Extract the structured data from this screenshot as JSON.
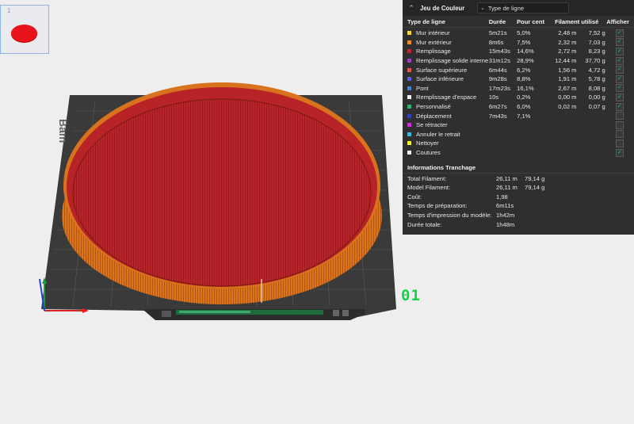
{
  "plate_thumbnail": {
    "index_label": "1"
  },
  "plate_number": "01",
  "bed_logo": "Bam",
  "panel": {
    "title": "Jeu de Couleur",
    "dropdown_value": "Type de ligne",
    "columns": {
      "type": "Type de ligne",
      "duration": "Durée",
      "percent": "Pour cent",
      "filament": "Filament utilisé",
      "show": "Afficher"
    },
    "rows": [
      {
        "label": "Mur intérieur",
        "color": "#f4d53b",
        "duration": "5m21s",
        "percent": "5,0%",
        "length": "2,48 m",
        "weight": "7,52 g",
        "checked": true
      },
      {
        "label": "Mur extérieur",
        "color": "#f08a2a",
        "duration": "8m6s",
        "percent": "7,5%",
        "length": "2,32 m",
        "weight": "7,03 g",
        "checked": true
      },
      {
        "label": "Remplissage",
        "color": "#c1272d",
        "duration": "15m43s",
        "percent": "14,6%",
        "length": "2,72 m",
        "weight": "8,23 g",
        "checked": true
      },
      {
        "label": "Remplissage solide interne",
        "color": "#9c3fbf",
        "duration": "31m12s",
        "percent": "28,9%",
        "length": "12,44 m",
        "weight": "37,70 g",
        "checked": true
      },
      {
        "label": "Surface supérieure",
        "color": "#e2564e",
        "duration": "6m44s",
        "percent": "6,2%",
        "length": "1,56 m",
        "weight": "4,72 g",
        "checked": true
      },
      {
        "label": "Surface inférieure",
        "color": "#5b5fd6",
        "duration": "9m28s",
        "percent": "8,8%",
        "length": "1,91 m",
        "weight": "5,78 g",
        "checked": true
      },
      {
        "label": "Pont",
        "color": "#4a84c8",
        "duration": "17m23s",
        "percent": "16,1%",
        "length": "2,67 m",
        "weight": "8,08 g",
        "checked": true
      },
      {
        "label": "Remplissage d'espace",
        "color": "#f2f2f2",
        "duration": "10s",
        "percent": "0,2%",
        "length": "0,00 m",
        "weight": "0,00 g",
        "checked": true
      },
      {
        "label": "Personnalisé",
        "color": "#2fb36b",
        "duration": "6m27s",
        "percent": "6,0%",
        "length": "0,02 m",
        "weight": "0,07 g",
        "checked": true
      },
      {
        "label": "Déplacement",
        "color": "#2f3fc0",
        "duration": "7m43s",
        "percent": "7,1%",
        "length": "",
        "weight": "",
        "checked": false
      },
      {
        "label": "Se rétracter",
        "color": "#d02fd0",
        "duration": "",
        "percent": "",
        "length": "",
        "weight": "",
        "checked": false
      },
      {
        "label": "Annuler le retrait",
        "color": "#3bb8d8",
        "duration": "",
        "percent": "",
        "length": "",
        "weight": "",
        "checked": false
      },
      {
        "label": "Nettoyer",
        "color": "#f5f53a",
        "duration": "",
        "percent": "",
        "length": "",
        "weight": "",
        "checked": false
      },
      {
        "label": "Coutures",
        "color": "#f2f2f2",
        "duration": "",
        "percent": "",
        "length": "",
        "weight": "",
        "checked": true
      }
    ],
    "info_title": "Informations Tranchage",
    "info": [
      {
        "label": "Total Filament:",
        "v1": "26,11 m",
        "v2": "79,14 g"
      },
      {
        "label": "Model Filament:",
        "v1": "26,11 m",
        "v2": "79,14 g"
      },
      {
        "label": "Coût:",
        "v1": "1,98",
        "v2": ""
      },
      {
        "label": "Temps de préparation:",
        "v1": "6m11s",
        "v2": ""
      },
      {
        "label": "Temps d'impression du modèle:",
        "v1": "1h42m",
        "v2": ""
      },
      {
        "label": "Durée totale:",
        "v1": "1h48m",
        "v2": ""
      }
    ]
  }
}
